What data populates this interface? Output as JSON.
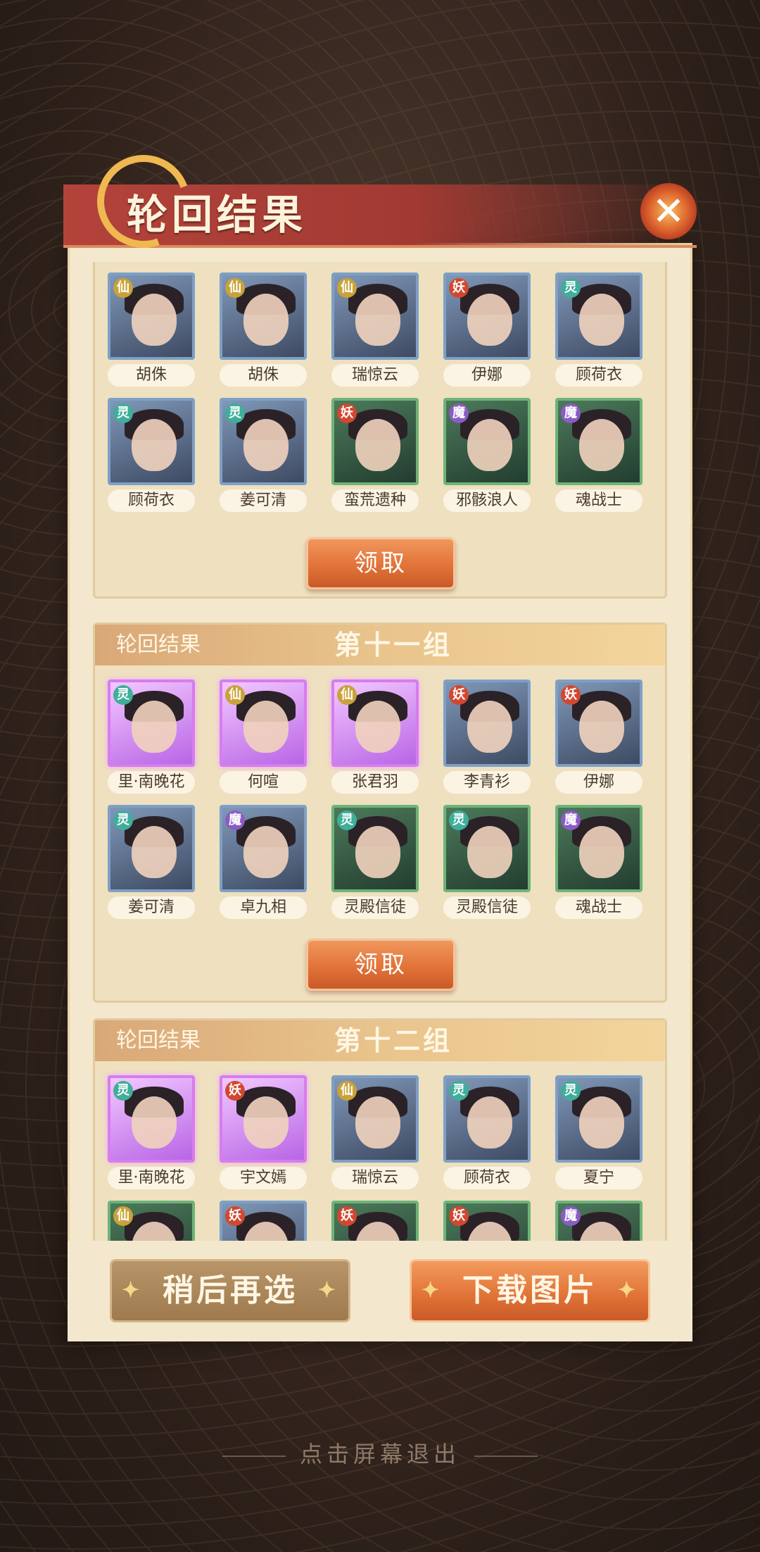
{
  "title": "轮回结果",
  "close_icon": "close-icon",
  "claim_label": "领取",
  "groups": [
    {
      "header_label": "",
      "header_name": "",
      "cards": [
        {
          "name": "胡侏",
          "badge": "仙",
          "frame": "blue"
        },
        {
          "name": "胡侏",
          "badge": "仙",
          "frame": "blue"
        },
        {
          "name": "瑞惊云",
          "badge": "仙",
          "frame": "blue"
        },
        {
          "name": "伊娜",
          "badge": "妖",
          "frame": "blue"
        },
        {
          "name": "顾荷衣",
          "badge": "灵",
          "frame": "blue"
        },
        {
          "name": "顾荷衣",
          "badge": "灵",
          "frame": "blue"
        },
        {
          "name": "姜可清",
          "badge": "灵",
          "frame": "blue"
        },
        {
          "name": "蛮荒遗种",
          "badge": "妖",
          "frame": "green"
        },
        {
          "name": "邪骸浪人",
          "badge": "魔",
          "frame": "green"
        },
        {
          "name": "魂战士",
          "badge": "魔",
          "frame": "green"
        }
      ]
    },
    {
      "header_label": "轮回结果",
      "header_name": "第十一组",
      "cards": [
        {
          "name": "里·南晚花",
          "badge": "灵",
          "frame": "purple"
        },
        {
          "name": "何喧",
          "badge": "仙",
          "frame": "purple"
        },
        {
          "name": "张君羽",
          "badge": "仙",
          "frame": "purple"
        },
        {
          "name": "李青衫",
          "badge": "妖",
          "frame": "blue"
        },
        {
          "name": "伊娜",
          "badge": "妖",
          "frame": "blue"
        },
        {
          "name": "姜可清",
          "badge": "灵",
          "frame": "blue"
        },
        {
          "name": "卓九相",
          "badge": "魔",
          "frame": "blue"
        },
        {
          "name": "灵殿信徒",
          "badge": "灵",
          "frame": "green"
        },
        {
          "name": "灵殿信徒",
          "badge": "灵",
          "frame": "green"
        },
        {
          "name": "魂战士",
          "badge": "魔",
          "frame": "green"
        }
      ]
    },
    {
      "header_label": "轮回结果",
      "header_name": "第十二组",
      "cards": [
        {
          "name": "里·南晚花",
          "badge": "灵",
          "frame": "purple"
        },
        {
          "name": "宇文嫣",
          "badge": "妖",
          "frame": "purple"
        },
        {
          "name": "瑞惊云",
          "badge": "仙",
          "frame": "blue"
        },
        {
          "name": "顾荷衣",
          "badge": "灵",
          "frame": "blue"
        },
        {
          "name": "夏宁",
          "badge": "灵",
          "frame": "blue"
        },
        {
          "name": "",
          "badge": "仙",
          "frame": "green"
        },
        {
          "name": "",
          "badge": "妖",
          "frame": "blue"
        },
        {
          "name": "",
          "badge": "妖",
          "frame": "green"
        },
        {
          "name": "",
          "badge": "妖",
          "frame": "green"
        },
        {
          "name": "",
          "badge": "魔",
          "frame": "green"
        }
      ]
    }
  ],
  "buttons": {
    "later": "稍后再选",
    "download": "下载图片"
  },
  "exit_hint": "点击屏幕退出"
}
